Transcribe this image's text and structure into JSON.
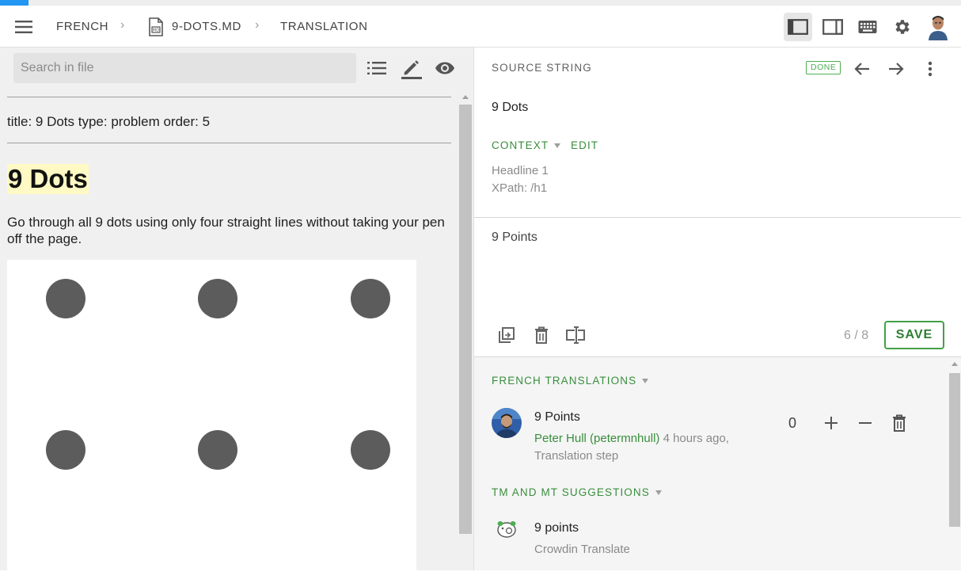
{
  "progress": {
    "fraction": 0.03,
    "color": "#2196f3"
  },
  "header": {
    "menu_icon": "menu-icon",
    "breadcrumb": {
      "project": "FRENCH",
      "file": "9-DOTS.MD",
      "section": "TRANSLATION"
    },
    "toolbar_icons": [
      "sidebar-left-icon",
      "sidebar-right-icon",
      "keyboard-icon",
      "gear-icon"
    ],
    "user_avatar": "user-avatar"
  },
  "left": {
    "search_placeholder": "Search in file",
    "icons": [
      "list-icon",
      "pencil-icon",
      "eye-icon"
    ],
    "front_matter": "title: 9 Dots type: problem order: 5",
    "heading": "9 Dots",
    "paragraph": "Go through all 9 dots using only four straight lines without taking your pen off the page."
  },
  "right": {
    "source_label": "SOURCE STRING",
    "status_badge": "DONE",
    "source_text": "9 Dots",
    "context_label": "CONTEXT",
    "edit_label": "EDIT",
    "context_lines": [
      "Headline 1",
      "XPath: /h1"
    ],
    "translation_text": "9 Points",
    "counter": "6 / 8",
    "save_label": "SAVE",
    "french_translations_label": "FRENCH TRANSLATIONS",
    "translation_entry": {
      "text": "9 Points",
      "author": "Peter Hull (petermnhull)",
      "time": " 4 hours ago,",
      "step": "Translation step",
      "votes": "0"
    },
    "tm_label": "TM AND MT SUGGESTIONS",
    "tm_entry": {
      "text": "9 points",
      "source": "Crowdin Translate"
    }
  },
  "colors": {
    "accent_green": "#388e3c",
    "highlight": "#fff9c4",
    "dot": "#5c5c5c"
  }
}
